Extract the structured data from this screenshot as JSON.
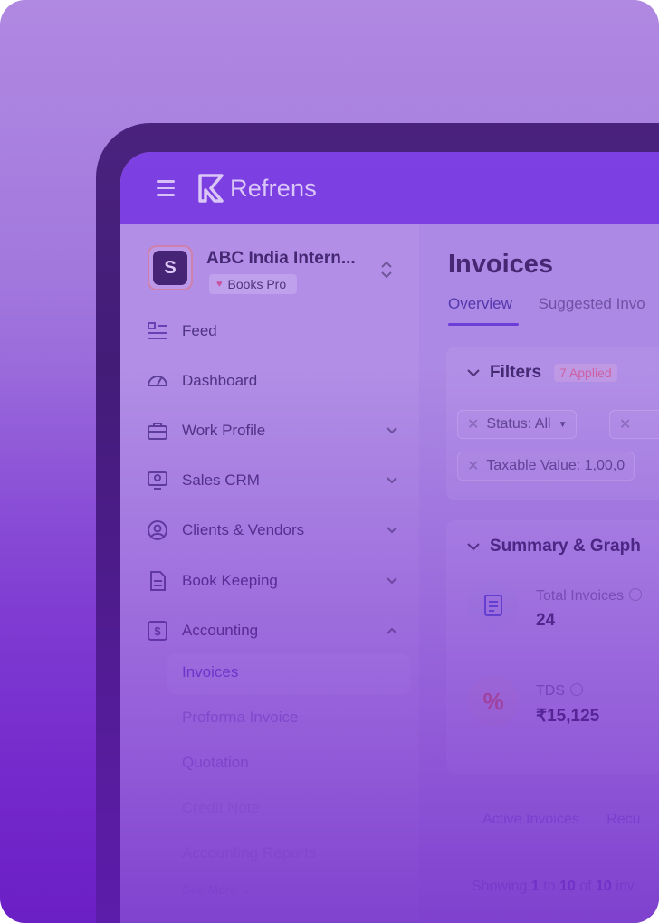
{
  "brand": {
    "name": "Refrens"
  },
  "org": {
    "name": "ABC India Intern...",
    "plan": "Books Pro"
  },
  "nav": {
    "items": [
      {
        "label": "Feed"
      },
      {
        "label": "Dashboard"
      },
      {
        "label": "Work Profile"
      },
      {
        "label": "Sales CRM"
      },
      {
        "label": "Clients & Vendors"
      },
      {
        "label": "Book Keeping"
      },
      {
        "label": "Accounting"
      }
    ],
    "accounting_sub": [
      {
        "label": "Invoices"
      },
      {
        "label": "Proforma Invoice"
      },
      {
        "label": "Quotation"
      },
      {
        "label": "Credit Note"
      },
      {
        "label": "Accounting Reports"
      }
    ],
    "see_more": "See More"
  },
  "page": {
    "title": "Invoices",
    "tabs": [
      {
        "label": "Overview"
      },
      {
        "label": "Suggested Invo"
      }
    ]
  },
  "filters": {
    "title": "Filters",
    "applied": "7 Applied",
    "chips": [
      {
        "label": "Status: All"
      },
      {
        "label": "Taxable Value: 1,00,0"
      }
    ]
  },
  "summary": {
    "title": "Summary & Graph",
    "stats": [
      {
        "label": "Total Invoices",
        "value": "24"
      },
      {
        "label": "TDS",
        "value": "₹15,125"
      }
    ]
  },
  "list": {
    "tabs": [
      {
        "label": "Active Invoices"
      },
      {
        "label": "Recu"
      }
    ],
    "showing_prefix": "Showing",
    "from": "1",
    "to_word": "to",
    "to": "10",
    "of_word": "of",
    "total": "10",
    "suffix": "inv"
  },
  "colors": {
    "accent": "#7a3ee4",
    "background_top": "#b693e3",
    "background_bottom": "#6e24c9"
  }
}
